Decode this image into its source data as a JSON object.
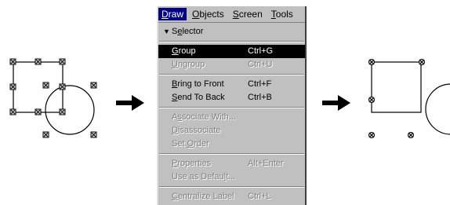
{
  "menubar": {
    "items": [
      {
        "text": "Draw",
        "mnemonic": "D",
        "rest": "raw",
        "active": true
      },
      {
        "text": "Objects",
        "mnemonic": "O",
        "rest": "bjects",
        "active": false
      },
      {
        "text": "Screen",
        "mnemonic": "S",
        "rest": "creen",
        "active": false
      },
      {
        "text": "Tools",
        "mnemonic": "T",
        "rest": "ools",
        "active": false
      }
    ]
  },
  "menu": {
    "selector": {
      "pre": "S",
      "mn": "e",
      "post": "lector",
      "checked": true
    },
    "group": {
      "mn": "G",
      "post": "roup",
      "shortcut": "Ctrl+G"
    },
    "ungroup": {
      "mn": "U",
      "post": "ngroup",
      "shortcut": "Ctrl+U"
    },
    "bring_front": {
      "mn": "B",
      "post": "ring to Front",
      "shortcut": "Ctrl+F"
    },
    "send_back": {
      "mn": "S",
      "post": "end To Back",
      "shortcut": "Ctrl+B"
    },
    "associate": {
      "pre": "A",
      "mn": "s",
      "post": "sociate With..."
    },
    "disassociate": {
      "mn": "D",
      "post": "isassociate"
    },
    "set_order": {
      "pre": "Set ",
      "mn": "O",
      "post": "rder"
    },
    "properties": {
      "mn": "P",
      "post": "roperties",
      "shortcut": "Alt+Enter"
    },
    "use_default": {
      "pre": "Use as Defau",
      "mn": "l",
      "post": "t..."
    },
    "centralize": {
      "mn": "C",
      "post": "entralize Label",
      "shortcut": "Ctrl+L"
    }
  },
  "colors": {
    "highlight": "#000000",
    "menu_bg": "#c0c0c0",
    "disabled": "#808080"
  },
  "icons": [
    "selection-handle-icon",
    "arrow-right-icon",
    "check-icon"
  ]
}
